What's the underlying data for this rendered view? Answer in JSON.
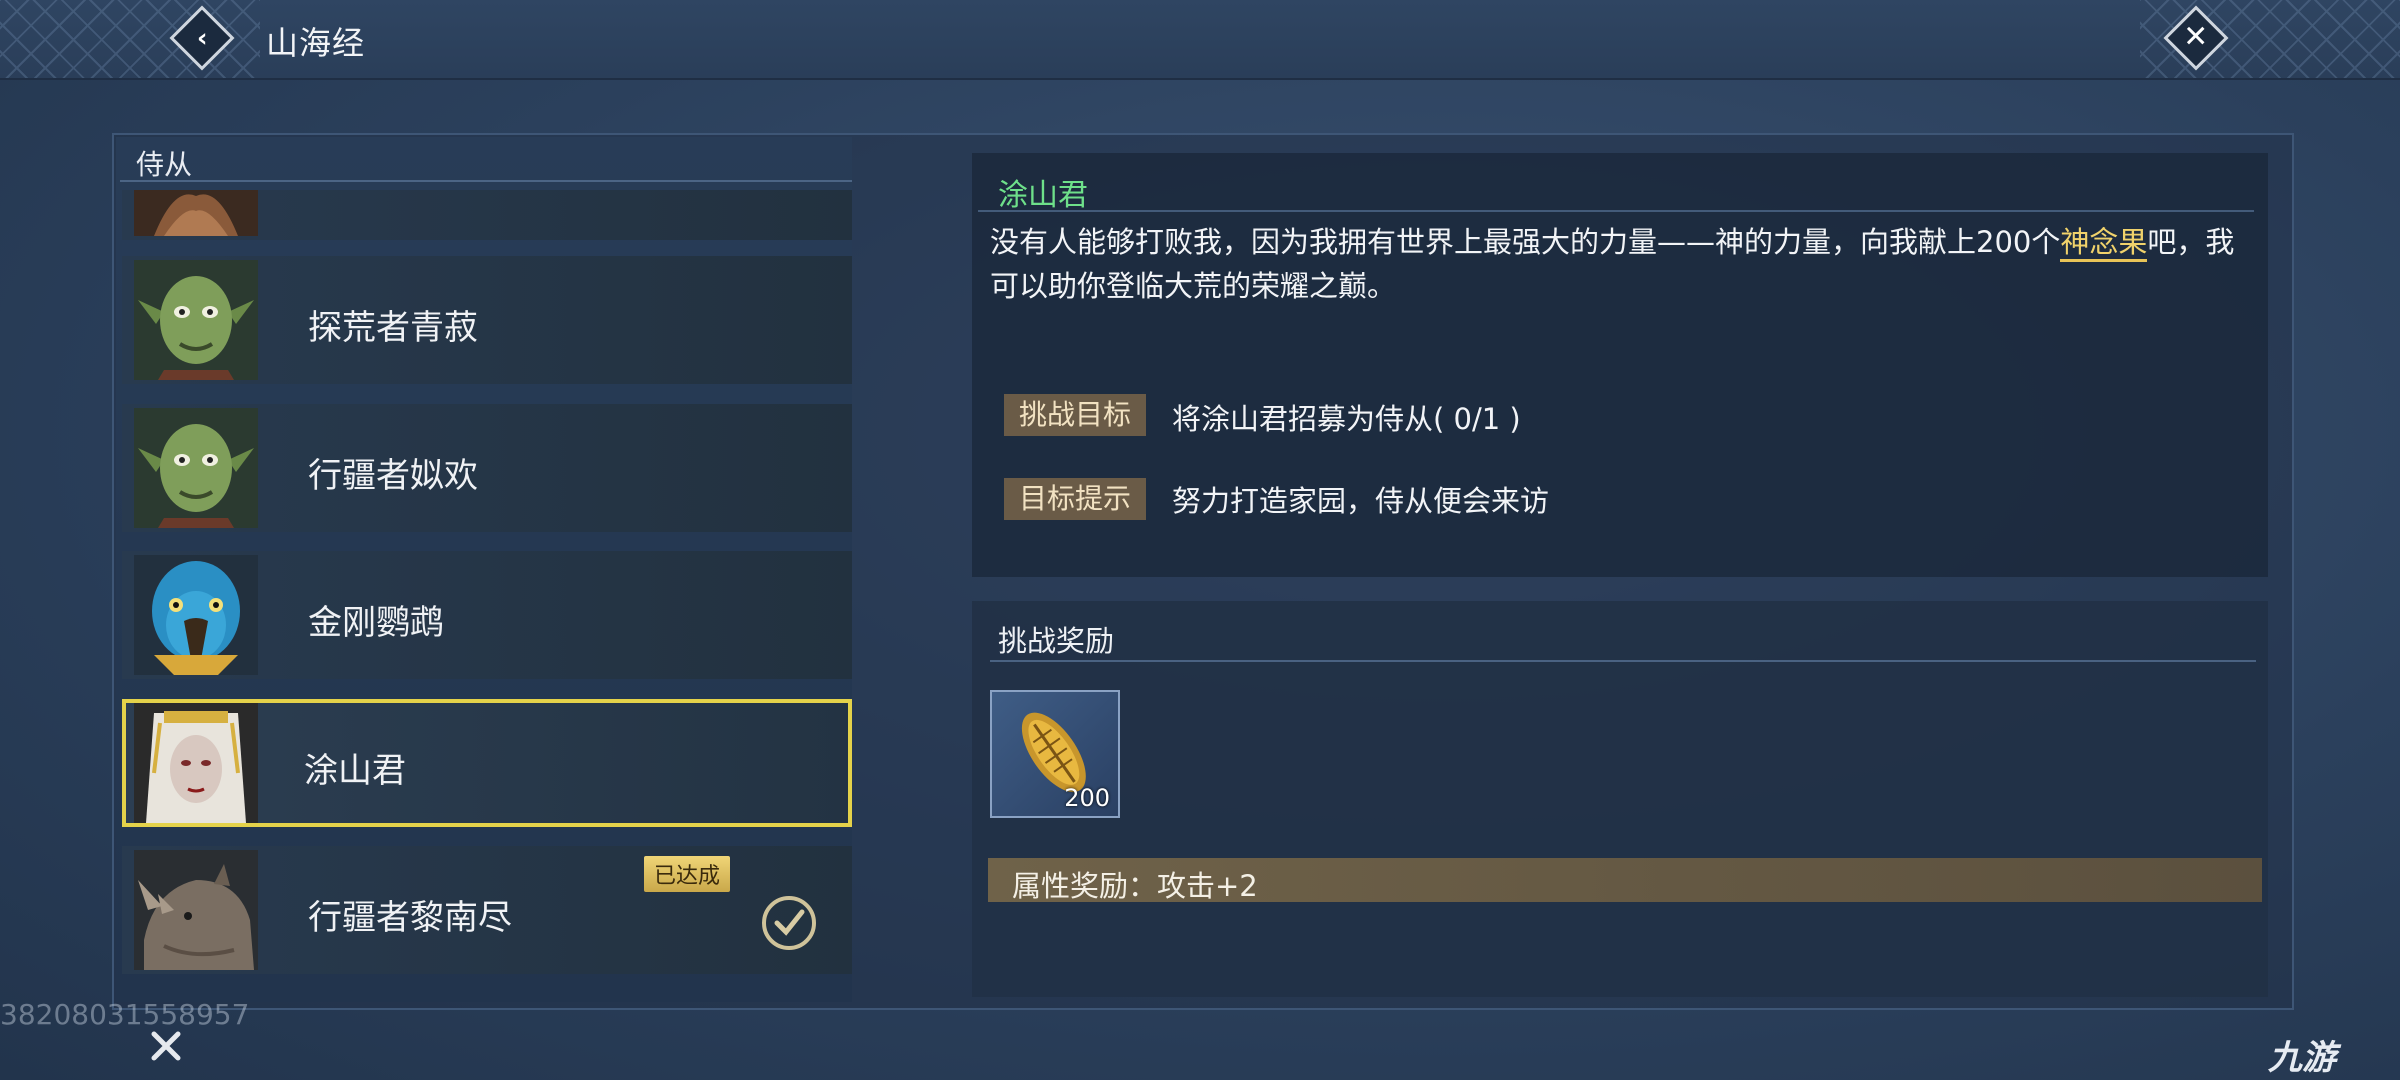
{
  "header": {
    "title": "山海经"
  },
  "list": {
    "header": "侍从",
    "items": [
      {
        "name": "",
        "status": "",
        "partial": true
      },
      {
        "name": "探荒者青菽",
        "status": ""
      },
      {
        "name": "行疆者姒欢",
        "status": ""
      },
      {
        "name": "金刚鹦鹉",
        "status": ""
      },
      {
        "name": "涂山君",
        "status": "",
        "selected": true
      },
      {
        "name": "行疆者黎南尽",
        "status": "已达成",
        "completed": true
      }
    ]
  },
  "detail": {
    "name": "涂山君",
    "description_pre": "没有人能够打败我，因为我拥有世界上最强大的力量——神的力量，向我献上200个",
    "description_highlight": "神念果",
    "description_post": "吧，我可以助你登临大荒的荣耀之巅。",
    "goal_label": "挑战目标",
    "goal_text": "将涂山君招募为侍从( 0/1 )",
    "hint_label": "目标提示",
    "hint_text": "努力打造家园，侍从便会来访"
  },
  "reward": {
    "title": "挑战奖励",
    "item_count": "200",
    "item_icon": "seed-icon",
    "attribute_text": "属性奖励：攻击+2"
  },
  "footer": {
    "id_text": "38208031558957",
    "logo_text": "九游"
  },
  "colors": {
    "selected_border": "#e4d24a",
    "name_green": "#6ee08a",
    "highlight_gold": "#f0d26b"
  }
}
